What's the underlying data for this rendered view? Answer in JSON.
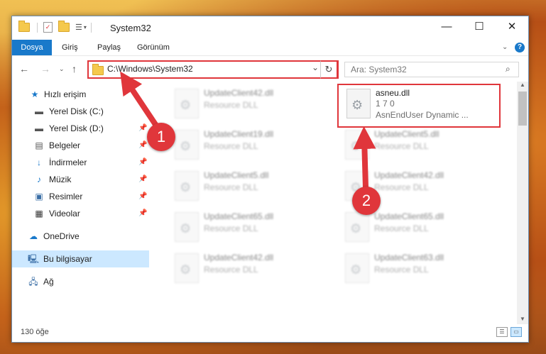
{
  "window": {
    "title": "System32"
  },
  "ribbon": {
    "tabs": [
      "Dosya",
      "Giriş",
      "Paylaş",
      "Görünüm"
    ]
  },
  "address": {
    "path": "C:\\Windows\\System32",
    "search_placeholder": "Ara: System32"
  },
  "sidebar": {
    "quick_access": "Hızlı erişim",
    "items": [
      {
        "label": "Yerel Disk (C:)",
        "icon": "drive-icon"
      },
      {
        "label": "Yerel Disk (D:)",
        "icon": "drive-icon"
      },
      {
        "label": "Belgeler",
        "icon": "documents-icon"
      },
      {
        "label": "İndirmeler",
        "icon": "download-icon"
      },
      {
        "label": "Müzik",
        "icon": "music-icon"
      },
      {
        "label": "Resimler",
        "icon": "pictures-icon"
      },
      {
        "label": "Videolar",
        "icon": "video-icon"
      }
    ],
    "onedrive": "OneDrive",
    "this_pc": "Bu bilgisayar",
    "network": "Ağ"
  },
  "files": {
    "highlighted": {
      "name": "asneu.dll",
      "version": "1 7 0",
      "desc": "AsnEndUser Dynamic ..."
    },
    "left_column": [
      {
        "name": "UpdateClient42.dll",
        "type": "Resource DLL"
      },
      {
        "name": "UpdateClient19.dll",
        "type": "Resource DLL"
      },
      {
        "name": "UpdateClient5.dll",
        "type": "Resource DLL"
      },
      {
        "name": "UpdateClient65.dll",
        "type": "Resource DLL"
      },
      {
        "name": "UpdateClient42.dll",
        "type": "Resource DLL"
      }
    ],
    "right_column": [
      {
        "name": "UpdateClient5.dll",
        "type": "Resource DLL"
      },
      {
        "name": "UpdateClient42.dll",
        "type": "Resource DLL"
      },
      {
        "name": "UpdateClient65.dll",
        "type": "Resource DLL"
      },
      {
        "name": "UpdateClient63.dll",
        "type": "Resource DLL"
      }
    ]
  },
  "status": {
    "count": "130 öğe"
  },
  "annotations": {
    "step1": "1",
    "step2": "2",
    "color": "#e0363b"
  }
}
